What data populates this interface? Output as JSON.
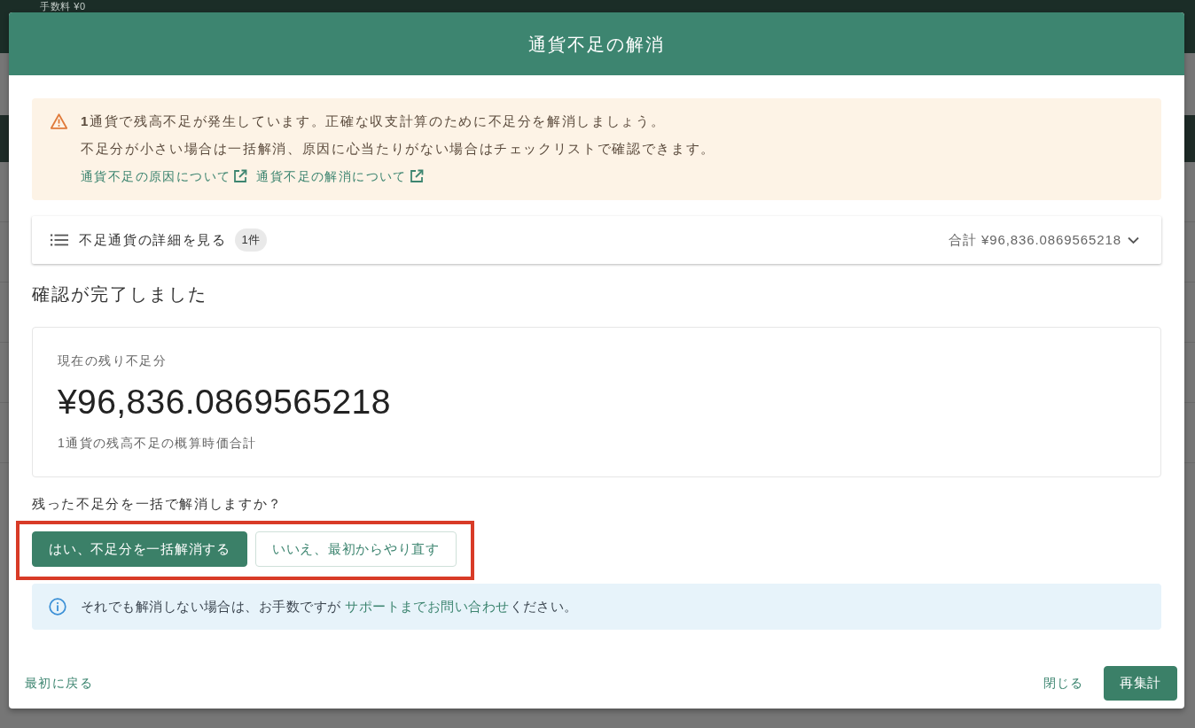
{
  "background": {
    "top_bar_text": "手数料 ¥0"
  },
  "dialog": {
    "title": "通貨不足の解消",
    "warning": {
      "lines": [
        "**1**通貨で残高不足が発生しています。正確な収支計算のために不足分を解消しましょう。",
        "不足分が小さい場合は一括解消、原因に心当たりがない場合はチェックリストで確認できます。"
      ],
      "links": [
        "通貨不足の原因について",
        "通貨不足の解消について"
      ]
    },
    "details": {
      "label": "不足通貨の詳細を見る",
      "badge": "1件",
      "total": "合計 ¥96,836.0869565218",
      "expanded": false
    },
    "status_heading": "確認が完了しました",
    "summary": {
      "label": "現在の残り不足分",
      "amount": "¥96,836.0869565218",
      "note": "1通貨の残高不足の概算時価合計"
    },
    "question": "残った不足分を一括で解消しますか？",
    "choices": {
      "highlighted": true,
      "buttons": [
        {
          "label": "はい、不足分を一括解消する",
          "kind": "primary"
        },
        {
          "label": "いいえ、最初からやり直す",
          "kind": "outline"
        }
      ]
    },
    "info": {
      "text_before": "それでも解消しない場合は、お手数ですが ",
      "link": "サポートまでお問い合わせ",
      "text_after": "ください。"
    },
    "footer": {
      "back_link": "最初に戻る",
      "close_link": "閉じる",
      "recalc_button": "再集計"
    }
  }
}
